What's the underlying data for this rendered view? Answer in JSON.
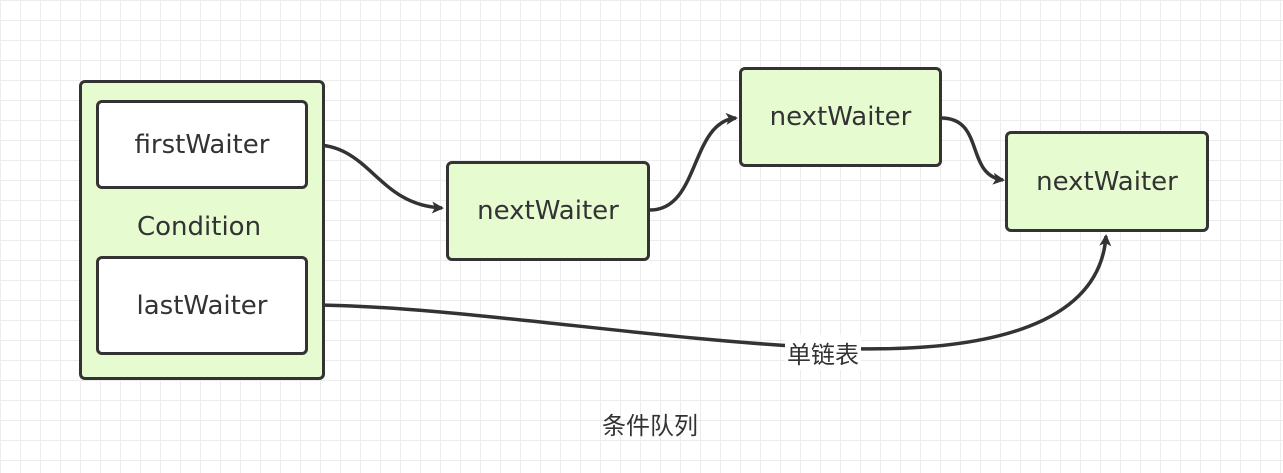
{
  "nodes": {
    "condition": "Condition",
    "first_waiter": "firstWaiter",
    "last_waiter": "lastWaiter",
    "next_waiter_1": "nextWaiter",
    "next_waiter_2": "nextWaiter",
    "next_waiter_3": "nextWaiter"
  },
  "edges": {
    "last_to_tail_label": "单链表"
  },
  "caption": "条件队列",
  "colors": {
    "node_fill": "#e6fbd0",
    "stroke": "#333333",
    "background_grid": "#ececec"
  }
}
